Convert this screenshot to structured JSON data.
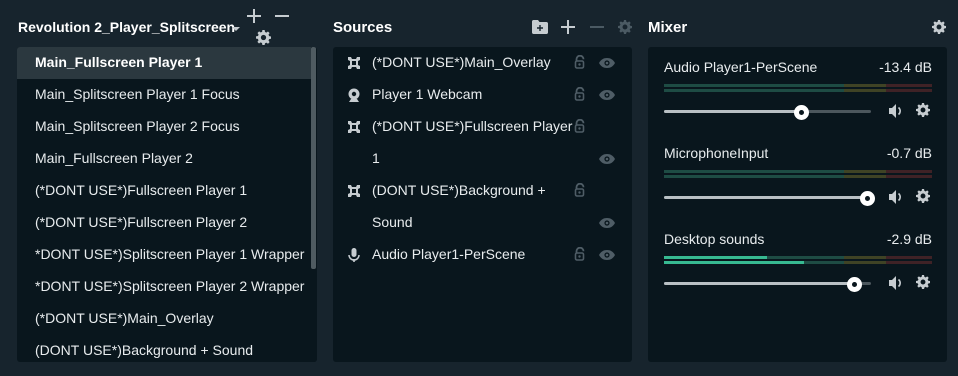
{
  "scenes": {
    "collection_name": "Revolution 2_Player_Splitscreen",
    "add_icon": "plus-icon",
    "remove_icon": "minus-icon",
    "settings_icon": "gear-icon",
    "items": [
      {
        "label": "Main_Fullscreen Player 1",
        "active": true
      },
      {
        "label": "Main_Splitscreen Player 1 Focus"
      },
      {
        "label": "Main_Splitscreen Player 2 Focus"
      },
      {
        "label": "Main_Fullscreen Player 2"
      },
      {
        "label": "(*DONT USE*)Fullscreen Player 1"
      },
      {
        "label": "(*DONT USE*)Fullscreen Player 2"
      },
      {
        "label": "*DONT USE*)Splitscreen Player 1 Wrapper"
      },
      {
        "label": "*DONT USE*)Splitscreen Player 2 Wrapper"
      },
      {
        "label": "(*DONT USE*)Main_Overlay"
      },
      {
        "label": "(DONT USE*)Background + Sound"
      }
    ]
  },
  "sources": {
    "title": "Sources",
    "rows": [
      {
        "text": "(*DONT USE*)Main_Overlay",
        "icon": "scene-icon",
        "lock": true,
        "eye": true
      },
      {
        "text": "Player 1 Webcam",
        "icon": "webcam-icon",
        "lock": true,
        "eye": true
      },
      {
        "text": "(*DONT USE*)Fullscreen Player",
        "icon": "scene-icon",
        "lock": true,
        "eye": false
      },
      {
        "text": "1",
        "icon": "",
        "lock": false,
        "eye": true
      },
      {
        "text": "(DONT USE*)Background +",
        "icon": "scene-icon",
        "lock": true,
        "eye": false
      },
      {
        "text": "Sound",
        "icon": "",
        "lock": false,
        "eye": true
      },
      {
        "text": "Audio Player1-PerScene",
        "icon": "microphone-icon",
        "lock": true,
        "eye": true
      }
    ]
  },
  "mixer": {
    "title": "Mixer",
    "items": [
      {
        "name": "Audio Player1-PerScene",
        "db": "-13.4 dB",
        "volume": 0.66,
        "meter_level": 0
      },
      {
        "name": "MicrophoneInput",
        "db": "-0.7 dB",
        "volume": 0.98,
        "meter_level": 0
      },
      {
        "name": "Desktop sounds",
        "db": "-2.9 dB",
        "volume": 0.92,
        "meter_level": 0.55
      }
    ]
  },
  "colors": {
    "background": "#17242d",
    "panel": "#09161d",
    "active_row": "#2b383f",
    "meter_green": "#2f7a64",
    "meter_yellow": "#6b6a2c",
    "meter_red": "#6b2e2e",
    "meter_level": "#37b991"
  }
}
